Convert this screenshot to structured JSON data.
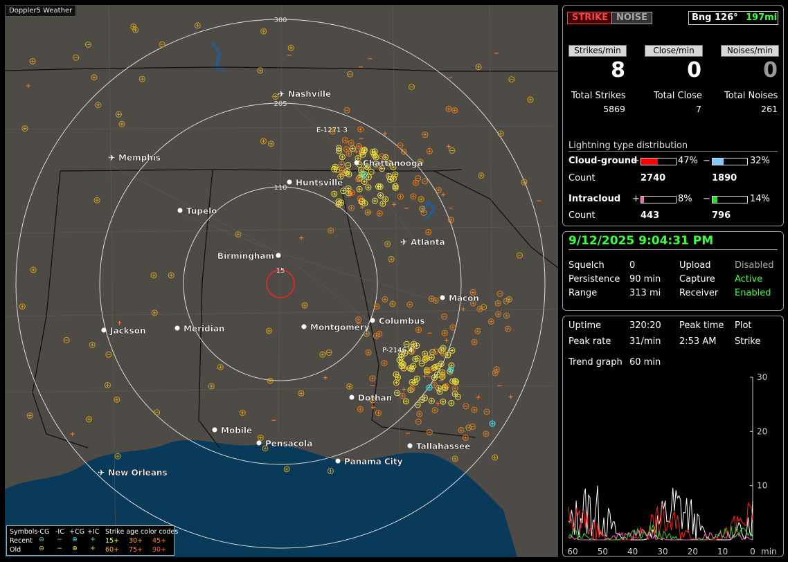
{
  "app": {
    "title": "Doppler5 Weather"
  },
  "header": {
    "strike_btn": "STRIKE",
    "noise_btn": "NOISE",
    "bearing_label": "Bng 126°",
    "bearing_distance": "197mi"
  },
  "rates": {
    "strikes_label": "Strikes/min",
    "strikes_value": "8",
    "close_label": "Close/min",
    "close_value": "0",
    "noises_label": "Noises/min",
    "noises_value": "0"
  },
  "totals": {
    "strikes_label": "Total Strikes",
    "strikes_value": "5869",
    "close_label": "Total Close",
    "close_value": "7",
    "noises_label": "Total Noises",
    "noises_value": "261"
  },
  "distribution": {
    "title": "Lightning type distribution",
    "cg_label": "Cloud-ground",
    "cg_pos_sign": "+",
    "cg_pos_pct": "47%",
    "cg_pos_fraction": 0.47,
    "cg_pos_color": "#ff0000",
    "cg_neg_sign": "−",
    "cg_neg_pct": "32%",
    "cg_neg_fraction": 0.32,
    "cg_neg_color": "#80c8ff",
    "count_label_1": "Count",
    "cg_pos_count": "2740",
    "cg_neg_count": "1890",
    "ic_label": "Intracloud",
    "ic_pos_sign": "+",
    "ic_pos_pct": "8%",
    "ic_pos_fraction": 0.08,
    "ic_pos_color": "#ff60c0",
    "ic_neg_sign": "−",
    "ic_neg_pct": "14%",
    "ic_neg_fraction": 0.14,
    "ic_neg_color": "#20e020",
    "count_label_2": "Count",
    "ic_pos_count": "443",
    "ic_neg_count": "796"
  },
  "status": {
    "datetime": "9/12/2025 9:04:31 PM",
    "squelch_label": "Squelch",
    "squelch_value": "0",
    "upload_label": "Upload",
    "upload_value": "Disabled",
    "persistence_label": "Persistence",
    "persistence_value": "90 min",
    "capture_label": "Capture",
    "capture_value": "Active",
    "range_label": "Range",
    "range_value": "313 mi",
    "receiver_label": "Receiver",
    "receiver_value": "Enabled"
  },
  "stats": {
    "uptime_label": "Uptime",
    "uptime_value": "320:20",
    "peak_time_label": "Peak time",
    "plot_label": "Plot",
    "peak_rate_label": "Peak rate",
    "peak_rate_value": "31/min",
    "peak_time_value": "2:53 AM",
    "plot_value": "Strike",
    "trend_label": "Trend graph",
    "trend_value": "60 min"
  },
  "chart_data": {
    "type": "line",
    "y_ticks": [
      "30",
      "20",
      "10"
    ],
    "x_ticks": [
      "60",
      "50",
      "40",
      "30",
      "20",
      "10",
      "0"
    ],
    "x_unit": "min",
    "ylim": [
      0,
      30
    ],
    "series_colors": [
      "#ffffff",
      "#ff2020",
      "#20e020",
      "#ff60c0"
    ]
  },
  "map": {
    "range_labels": [
      "300",
      "205",
      "110",
      "15"
    ],
    "cities": [
      {
        "name": "Nashville",
        "type": "airport"
      },
      {
        "name": "Memphis",
        "type": "airport"
      },
      {
        "name": "Chattanooga",
        "type": "city"
      },
      {
        "name": "Huntsville",
        "type": "city"
      },
      {
        "name": "Tupelo",
        "type": "city"
      },
      {
        "name": "Atlanta",
        "type": "airport"
      },
      {
        "name": "Birmingham",
        "type": "city"
      },
      {
        "name": "Macon",
        "type": "city"
      },
      {
        "name": "Columbus",
        "type": "city"
      },
      {
        "name": "Jackson",
        "type": "city"
      },
      {
        "name": "Meridian",
        "type": "city"
      },
      {
        "name": "Montgomery",
        "type": "city"
      },
      {
        "name": "Dothan",
        "type": "city"
      },
      {
        "name": "Mobile",
        "type": "city"
      },
      {
        "name": "Pensacola",
        "type": "city"
      },
      {
        "name": "Tallahassee",
        "type": "city"
      },
      {
        "name": "Panama City",
        "type": "city"
      },
      {
        "name": "New Orleans",
        "type": "airport"
      }
    ],
    "storm_labels": [
      "E-1271 3",
      "P-2146 4"
    ]
  },
  "legend": {
    "symbols_label": "Symbols",
    "cg_neg": "-CG",
    "ic_neg": "-IC",
    "cg_pos": "+CG",
    "ic_pos": "+IC",
    "age_title": "Strike age color codes",
    "recent_label": "Recent",
    "old_label": "Old",
    "age_recent": [
      "15+",
      "30+",
      "45+"
    ],
    "age_old": [
      "60+",
      "75+",
      "90+"
    ]
  }
}
